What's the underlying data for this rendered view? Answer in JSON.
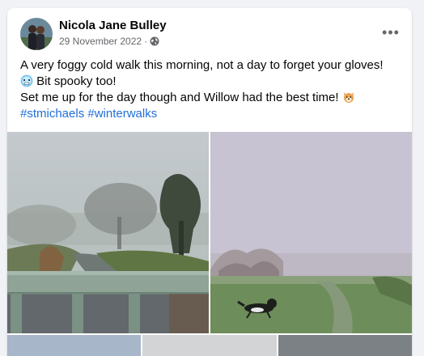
{
  "post": {
    "author": "Nicola Jane Bulley",
    "date": "29 November 2022",
    "separator": "·",
    "privacy_icon": "globe-icon",
    "more_icon": "more-options-icon",
    "more_label": "•••",
    "text_line1": "A very foggy cold walk this morning, not a day to forget your gloves!",
    "text_line2": "Bit spooky too!",
    "text_line3": "Set me up for the day though and Willow had the best time!",
    "emoji_cold": "cold-face-emoji",
    "emoji_dog": "dog-face-emoji",
    "hashtag1": "#stmichaels",
    "hashtag2": "#winterwalks"
  },
  "colors": {
    "hashtag": "#216fdb",
    "secondary_text": "#65676b",
    "page_background": "#f0f2f5"
  }
}
